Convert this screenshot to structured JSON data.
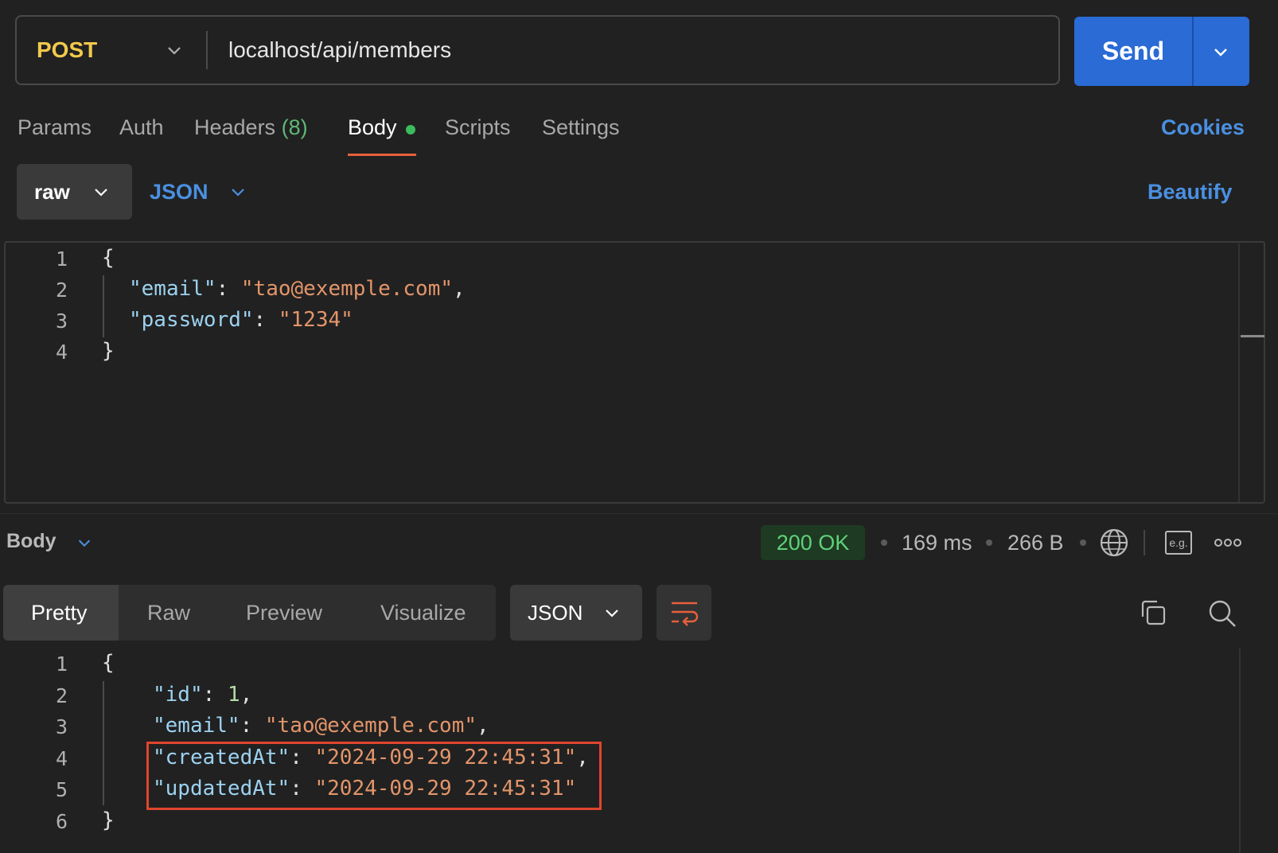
{
  "request": {
    "method": "POST",
    "url": "localhost/api/members",
    "send_label": "Send"
  },
  "tabs": {
    "params": "Params",
    "auth": "Auth",
    "headers": "Headers",
    "headers_count": "(8)",
    "body": "Body",
    "scripts": "Scripts",
    "settings": "Settings",
    "cookies": "Cookies"
  },
  "body_options": {
    "mode": "raw",
    "type": "JSON",
    "beautify": "Beautify"
  },
  "request_body": {
    "line_numbers": [
      "1",
      "2",
      "3",
      "4"
    ],
    "open_brace": "{",
    "close_brace": "}",
    "email_key": "\"email\"",
    "email_value": "\"tao@exemple.com\"",
    "password_key": "\"password\"",
    "password_value": "\"1234\"",
    "colon": ": ",
    "comma": ","
  },
  "response": {
    "title": "Body",
    "status": "200 OK",
    "time": "169 ms",
    "size": "266 B",
    "example_label": "e.g.",
    "views": [
      "Pretty",
      "Raw",
      "Preview",
      "Visualize"
    ],
    "active_view": "Pretty",
    "format": "JSON",
    "line_numbers": [
      "1",
      "2",
      "3",
      "4",
      "5",
      "6"
    ],
    "open_brace": "{",
    "close_brace": "}",
    "id_key": "\"id\"",
    "id_value": "1",
    "email_key": "\"email\"",
    "email_value": "\"tao@exemple.com\"",
    "created_key": "\"createdAt\"",
    "created_value": "\"2024-09-29 22:45:31\"",
    "updated_key": "\"updatedAt\"",
    "updated_value": "\"2024-09-29 22:45:31\"",
    "colon": ": ",
    "comma": ","
  },
  "colors": {
    "method": "#f2c94c",
    "send": "#2a6bd5",
    "accent_link": "#4a90e2",
    "active_tab_underline": "#e8603c",
    "status_ok": "#5fd17a",
    "highlight_box": "#e0452e"
  },
  "icons": [
    "chevron-down-icon",
    "globe-icon",
    "example-icon",
    "more-icon",
    "wrap-lines-icon",
    "copy-icon",
    "search-icon"
  ]
}
